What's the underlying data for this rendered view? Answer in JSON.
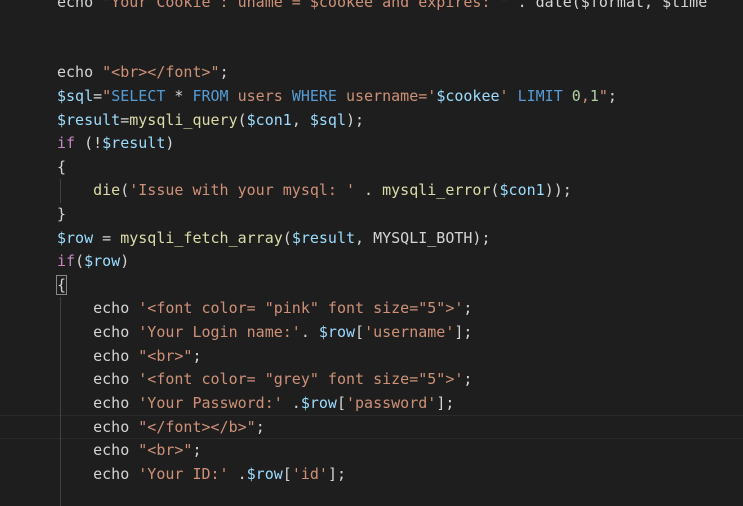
{
  "editor": {
    "colors": {
      "background": "#1e1e1e",
      "keyword": "#569cd6",
      "control": "#c586c0",
      "function": "#dcdcaa",
      "variable": "#9cdcfe",
      "string": "#ce9178",
      "number": "#b5cea8",
      "plain": "#d4d4d4"
    },
    "lines": [
      [
        {
          "t": "echo ",
          "c": "plain"
        },
        {
          "t": "\"Your Cookie : uname = $cookee and expires: \"",
          "c": "str"
        },
        {
          "t": " . date($format, $time",
          "c": "plain"
        }
      ],
      [],
      [],
      [
        {
          "t": "echo ",
          "c": "plain"
        },
        {
          "t": "\"<br></font>\"",
          "c": "str"
        },
        {
          "t": ";",
          "c": "plain"
        }
      ],
      [
        {
          "t": "$sql",
          "c": "var"
        },
        {
          "t": "=",
          "c": "plain"
        },
        {
          "t": "\"",
          "c": "str"
        },
        {
          "t": "SELECT",
          "c": "kw"
        },
        {
          "t": " * ",
          "c": "plain"
        },
        {
          "t": "FROM",
          "c": "kw"
        },
        {
          "t": " users ",
          "c": "str"
        },
        {
          "t": "WHERE",
          "c": "kw"
        },
        {
          "t": " username='",
          "c": "str"
        },
        {
          "t": "$cookee",
          "c": "var"
        },
        {
          "t": "' ",
          "c": "str"
        },
        {
          "t": "LIMIT",
          "c": "kw"
        },
        {
          "t": " ",
          "c": "str"
        },
        {
          "t": "0",
          "c": "num"
        },
        {
          "t": ",",
          "c": "str"
        },
        {
          "t": "1",
          "c": "num"
        },
        {
          "t": "\"",
          "c": "str"
        },
        {
          "t": ";",
          "c": "plain"
        }
      ],
      [
        {
          "t": "$result",
          "c": "var"
        },
        {
          "t": "=",
          "c": "plain"
        },
        {
          "t": "mysqli_query",
          "c": "fn"
        },
        {
          "t": "(",
          "c": "plain"
        },
        {
          "t": "$con1",
          "c": "var"
        },
        {
          "t": ", ",
          "c": "plain"
        },
        {
          "t": "$sql",
          "c": "var"
        },
        {
          "t": ");",
          "c": "plain"
        }
      ],
      [
        {
          "t": "if",
          "c": "ctl"
        },
        {
          "t": " (!",
          "c": "plain"
        },
        {
          "t": "$result",
          "c": "var"
        },
        {
          "t": ")",
          "c": "plain"
        }
      ],
      [
        {
          "t": "{",
          "c": "plain"
        }
      ],
      [
        {
          "t": "    ",
          "c": "plain"
        },
        {
          "t": "die",
          "c": "fn"
        },
        {
          "t": "(",
          "c": "plain"
        },
        {
          "t": "'Issue with your mysql: '",
          "c": "str"
        },
        {
          "t": " . ",
          "c": "plain"
        },
        {
          "t": "mysqli_error",
          "c": "fn"
        },
        {
          "t": "(",
          "c": "plain"
        },
        {
          "t": "$con1",
          "c": "var"
        },
        {
          "t": "));",
          "c": "plain"
        }
      ],
      [
        {
          "t": "}",
          "c": "plain"
        }
      ],
      [
        {
          "t": "$row",
          "c": "var"
        },
        {
          "t": " = ",
          "c": "plain"
        },
        {
          "t": "mysqli_fetch_array",
          "c": "fn"
        },
        {
          "t": "(",
          "c": "plain"
        },
        {
          "t": "$result",
          "c": "var"
        },
        {
          "t": ", MYSQLI_BOTH);",
          "c": "plain"
        }
      ],
      [
        {
          "t": "if",
          "c": "ctl"
        },
        {
          "t": "(",
          "c": "plain"
        },
        {
          "t": "$row",
          "c": "var"
        },
        {
          "t": ")",
          "c": "plain"
        }
      ],
      [
        {
          "t": "{",
          "c": "plain",
          "box": true
        }
      ],
      [
        {
          "t": "    echo ",
          "c": "plain"
        },
        {
          "t": "'<font color= \"pink\" font size=\"5\">'",
          "c": "str"
        },
        {
          "t": ";",
          "c": "plain"
        }
      ],
      [
        {
          "t": "    echo ",
          "c": "plain"
        },
        {
          "t": "'Your Login name:'",
          "c": "str"
        },
        {
          "t": ". ",
          "c": "plain"
        },
        {
          "t": "$row",
          "c": "var"
        },
        {
          "t": "[",
          "c": "plain"
        },
        {
          "t": "'username'",
          "c": "str"
        },
        {
          "t": "];",
          "c": "plain"
        }
      ],
      [
        {
          "t": "    echo ",
          "c": "plain"
        },
        {
          "t": "\"<br>\"",
          "c": "str"
        },
        {
          "t": ";",
          "c": "plain"
        }
      ],
      [
        {
          "t": "    echo ",
          "c": "plain"
        },
        {
          "t": "'<font color= \"grey\" font size=\"5\">'",
          "c": "str"
        },
        {
          "t": ";",
          "c": "plain"
        }
      ],
      [
        {
          "t": "    echo ",
          "c": "plain"
        },
        {
          "t": "'Your Password:'",
          "c": "str"
        },
        {
          "t": " .",
          "c": "plain"
        },
        {
          "t": "$row",
          "c": "var"
        },
        {
          "t": "[",
          "c": "plain"
        },
        {
          "t": "'password'",
          "c": "str"
        },
        {
          "t": "];",
          "c": "plain"
        }
      ],
      [
        {
          "t": "    echo ",
          "c": "plain"
        },
        {
          "t": "\"</font></b>\"",
          "c": "str"
        },
        {
          "t": ";",
          "c": "plain"
        }
      ],
      [
        {
          "t": "    echo ",
          "c": "plain"
        },
        {
          "t": "\"<br>\"",
          "c": "str"
        },
        {
          "t": ";",
          "c": "plain"
        }
      ],
      [
        {
          "t": "    echo ",
          "c": "plain"
        },
        {
          "t": "'Your ID:'",
          "c": "str"
        },
        {
          "t": " .",
          "c": "plain"
        },
        {
          "t": "$row",
          "c": "var"
        },
        {
          "t": "[",
          "c": "plain"
        },
        {
          "t": "'id'",
          "c": "str"
        },
        {
          "t": "];",
          "c": "plain"
        }
      ]
    ],
    "current_line": 18
  }
}
